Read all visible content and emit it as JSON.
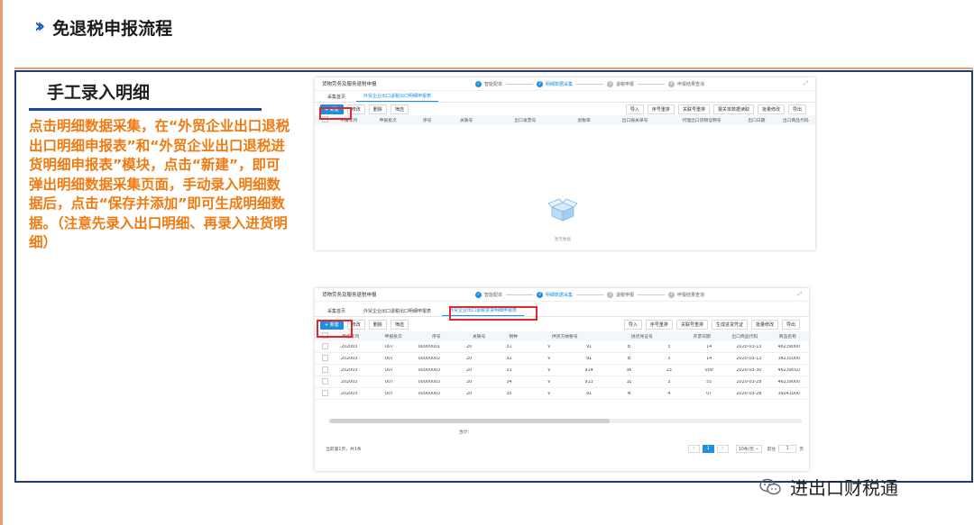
{
  "slide": {
    "title": "免退税申报流程",
    "section_title": "手工录入明细",
    "description": "点击明细数据采集，在“外贸企业出口退税出口明细申报表”和“外贸企业出口退税进货明细申报表”模块，点击“新建”，即可弹出明细数据采集页面，手动录入明细数据后，点击“保存并添加”即可生成明细数据。（注意先录入出口明细、再录入进货明细）",
    "watermark": "进出口财税通",
    "colors": {
      "accent_blue": "#1c5fc4",
      "accent_orange": "#f07a10",
      "highlight_red": "#e5262a"
    }
  },
  "screen1": {
    "app_title": "货物劳务及服务退税申报",
    "steps": [
      "智能配单",
      "明细数据采集",
      "退税申报",
      "申报结果查询"
    ],
    "tabs": [
      "采集首页",
      "外贸企业出口退税出口明细申报表"
    ],
    "toolbar_left": [
      "+ 新建",
      "修改",
      "删除",
      "筛选"
    ],
    "toolbar_right": [
      "导入",
      "序号重排",
      "关联号重排",
      "报关单数据读取",
      "批量修改",
      "导出"
    ],
    "columns": [
      "申报年月",
      "申报批次",
      "序号",
      "关联号",
      "出口发票号",
      "退税率",
      "出口报关单号",
      "代理出口货物证明号",
      "出口日期",
      "出口商品代码"
    ],
    "empty_text": "暂无数据"
  },
  "screen2": {
    "app_title": "货物劳务及服务退税申报",
    "steps": [
      "智能配单",
      "明细数据采集",
      "退税申报",
      "申报结果查询"
    ],
    "tabs": [
      "采集首页",
      "外贸企业出口退税出口明细申报表",
      "外贸企业出口退税进货明细申报表"
    ],
    "toolbar_left": [
      "+ 新建",
      "修改",
      "删除",
      "筛选"
    ],
    "toolbar_right": [
      "导入",
      "序号重排",
      "关联号重排",
      "生成进货凭证",
      "批量修改",
      "导出"
    ],
    "columns": [
      "申报年月",
      "申报批次",
      "序号",
      "关联号",
      "税种",
      "供货方纳税号",
      "进货凭证号",
      "开票日期",
      "出口商品代码",
      "商品名称"
    ],
    "rows": [
      [
        "202003",
        "007",
        "00000001",
        "20",
        "31",
        "V",
        "91",
        "B",
        "3",
        "14",
        "2020-03-13",
        "46239000"
      ],
      [
        "202003",
        "007",
        "00000002",
        "20",
        "32",
        "V",
        "91",
        "B",
        "3",
        "14",
        "2020-03-13",
        "38235000"
      ],
      [
        "202003",
        "007",
        "00000003",
        "20",
        "33",
        "V",
        "914",
        "3K",
        "23",
        "000",
        "2020-03-30",
        "46239010"
      ],
      [
        "202003",
        "007",
        "00000003",
        "20",
        "34",
        "V",
        "913",
        "1L",
        "3",
        "55",
        "2020-03-28",
        "46239000"
      ],
      [
        "202003",
        "007",
        "00000003",
        "20",
        "35",
        "V",
        "91",
        "N",
        "4",
        "07",
        "2020-03-28",
        "39241000"
      ]
    ],
    "subtotal": "合计：",
    "footer_info": "当前第1页，共1条",
    "page_current": "1",
    "page_size": "10条/页",
    "goto_label": "前往",
    "goto_value": "1",
    "page_suffix": "页"
  }
}
